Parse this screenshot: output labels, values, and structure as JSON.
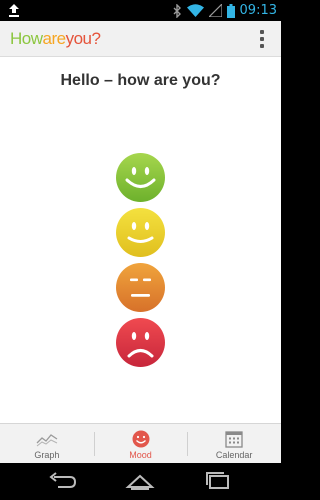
{
  "status_bar": {
    "time": "09:13",
    "icons": [
      "upload-icon",
      "bluetooth-icon",
      "wifi-icon",
      "signal-icon",
      "battery-icon"
    ]
  },
  "action_bar": {
    "title_part1": "How",
    "title_part2": "are",
    "title_part3": "you?",
    "menu_icon": "overflow-menu-icon"
  },
  "main": {
    "greeting": "Hello – how are you?",
    "moods": [
      {
        "name": "happy",
        "color_top": "#9fd24a",
        "color_bottom": "#6fb52e"
      },
      {
        "name": "content",
        "color_top": "#f2de3a",
        "color_bottom": "#e1c21f"
      },
      {
        "name": "neutral",
        "color_top": "#efa13a",
        "color_bottom": "#d9762a"
      },
      {
        "name": "sad",
        "color_top": "#ef4a4f",
        "color_bottom": "#c9283c"
      }
    ]
  },
  "tabs": [
    {
      "label": "Graph",
      "icon": "graph-icon",
      "active": false
    },
    {
      "label": "Mood",
      "icon": "smiley-icon",
      "active": true
    },
    {
      "label": "Calendar",
      "icon": "calendar-icon",
      "active": false
    }
  ],
  "nav_bar": {
    "buttons": [
      "back-icon",
      "home-icon",
      "recents-icon"
    ]
  },
  "colors": {
    "accent": "#e2574c",
    "status_time": "#33b5e5"
  }
}
